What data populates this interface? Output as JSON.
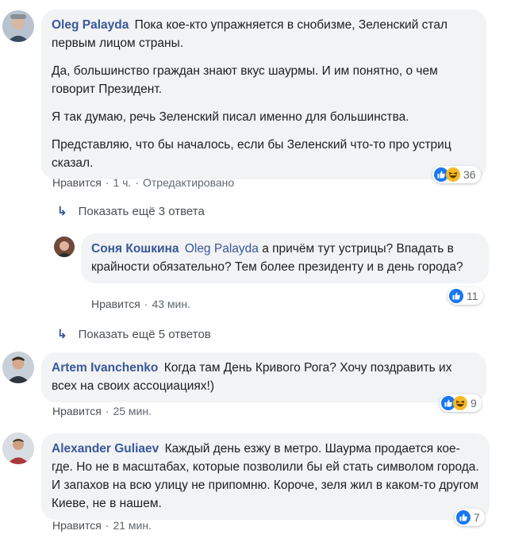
{
  "comments": [
    {
      "author": "Oleg Palayda",
      "paragraphs": [
        "Пока кое-кто упражняется в снобизме, Зеленский стал первым лицом страны.",
        "Да, большинство граждан знают вкус шаурмы. И им понятно, о чем говорит Президент.",
        "Я так думаю, речь Зеленский писал именно для большинства.",
        "Представляю, что бы началось, если бы Зеленский что-то про устриц сказал."
      ],
      "like_label": "Нравится",
      "time": "1 ч.",
      "edited": "Отредактировано",
      "reactions": [
        "like",
        "haha"
      ],
      "reaction_count": "36"
    },
    {
      "author": "Соня Кошкина",
      "mention": "Oleg Palayda",
      "text": "а причём тут устрицы? Впадать в крайности обязательно? Тем более президенту и в день города?",
      "like_label": "Нравится",
      "time": "43 мин.",
      "reactions": [
        "like"
      ],
      "reaction_count": "11"
    },
    {
      "author": "Artem Ivanchenko",
      "text": "Когда там День Кривого Рога? Хочу поздравить их всех на своих ассоциациях!)",
      "like_label": "Нравится",
      "time": "25 мин.",
      "reactions": [
        "like",
        "haha"
      ],
      "reaction_count": "9"
    },
    {
      "author": "Alexander Guliaev",
      "text": "Каждый день езжу в метро. Шаурма продается кое-где. Но не в масштабах, которые позволили бы ей стать символом города. И запахов на всю улицу не припомню. Короче, зеля жил в каком-то другом Киеве, не в нашем.",
      "like_label": "Нравится",
      "time": "21 мин.",
      "reactions": [
        "like"
      ],
      "reaction_count": "7"
    }
  ],
  "show_more": [
    "Показать ещё 3 ответа",
    "Показать ещё 5 ответов"
  ],
  "colors": {
    "link": "#385898",
    "bubble": "#f2f3f5",
    "meta": "#606770",
    "like_blue": "#1877f2",
    "haha_yellow": "#f7b928"
  },
  "icons": [
    "reply-arrow-icon",
    "like-reaction-icon",
    "haha-reaction-icon"
  ]
}
